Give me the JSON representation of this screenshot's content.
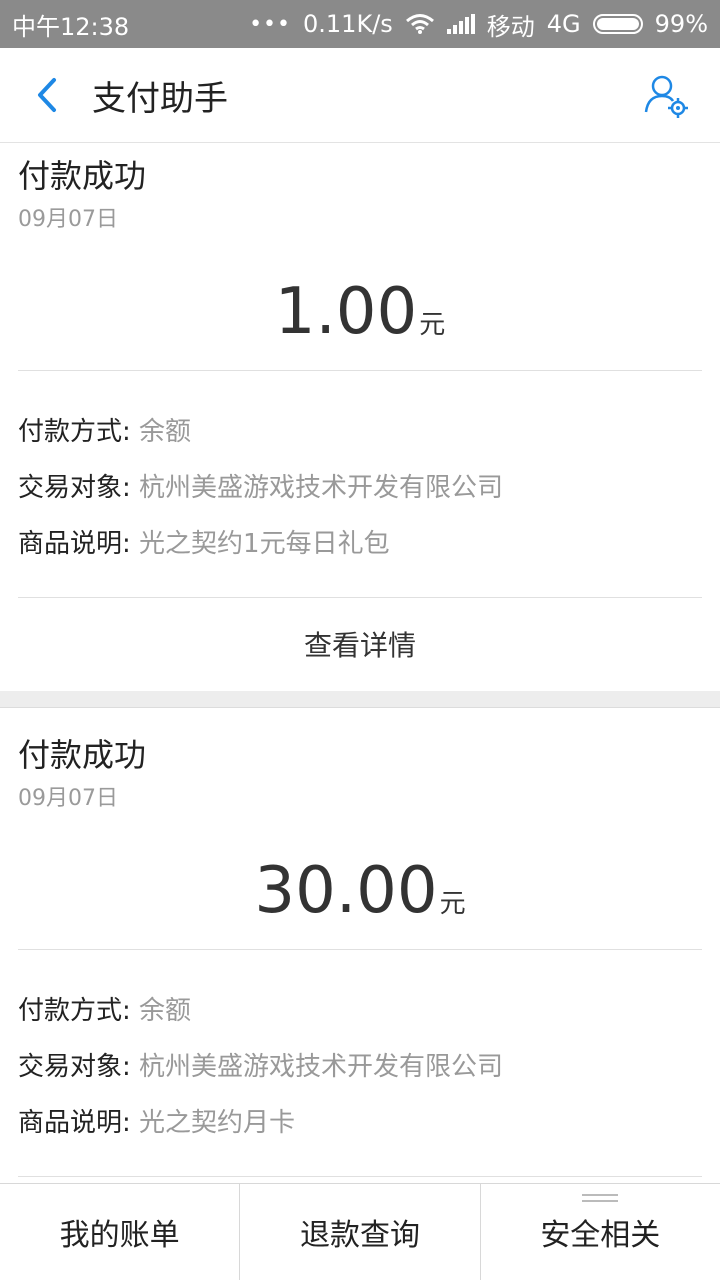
{
  "status_bar": {
    "time": "中午12:38",
    "dots": "•••",
    "speed": "0.11K/s",
    "carrier": "移动",
    "network": "4G",
    "battery": "99%",
    "icons": [
      "wifi-icon",
      "signal-icon",
      "battery-icon"
    ]
  },
  "header": {
    "title": "支付助手",
    "back_icon": "chevron-left-icon",
    "settings_icon": "user-settings-icon",
    "accent_color": "#1e88e5"
  },
  "cards": [
    {
      "status": "付款成功",
      "date": "09月07日",
      "amount": "1.00",
      "unit": "元",
      "rows": [
        {
          "label": "付款方式:",
          "value": "余额"
        },
        {
          "label": "交易对象:",
          "value": "杭州美盛游戏技术开发有限公司"
        },
        {
          "label": "商品说明:",
          "value": "光之契约1元每日礼包"
        }
      ],
      "action": "查看详情"
    },
    {
      "status": "付款成功",
      "date": "09月07日",
      "amount": "30.00",
      "unit": "元",
      "rows": [
        {
          "label": "付款方式:",
          "value": "余额"
        },
        {
          "label": "交易对象:",
          "value": "杭州美盛游戏技术开发有限公司"
        },
        {
          "label": "商品说明:",
          "value": "光之契约月卡"
        }
      ]
    }
  ],
  "tabs": [
    "我的账单",
    "退款查询",
    "安全相关"
  ]
}
